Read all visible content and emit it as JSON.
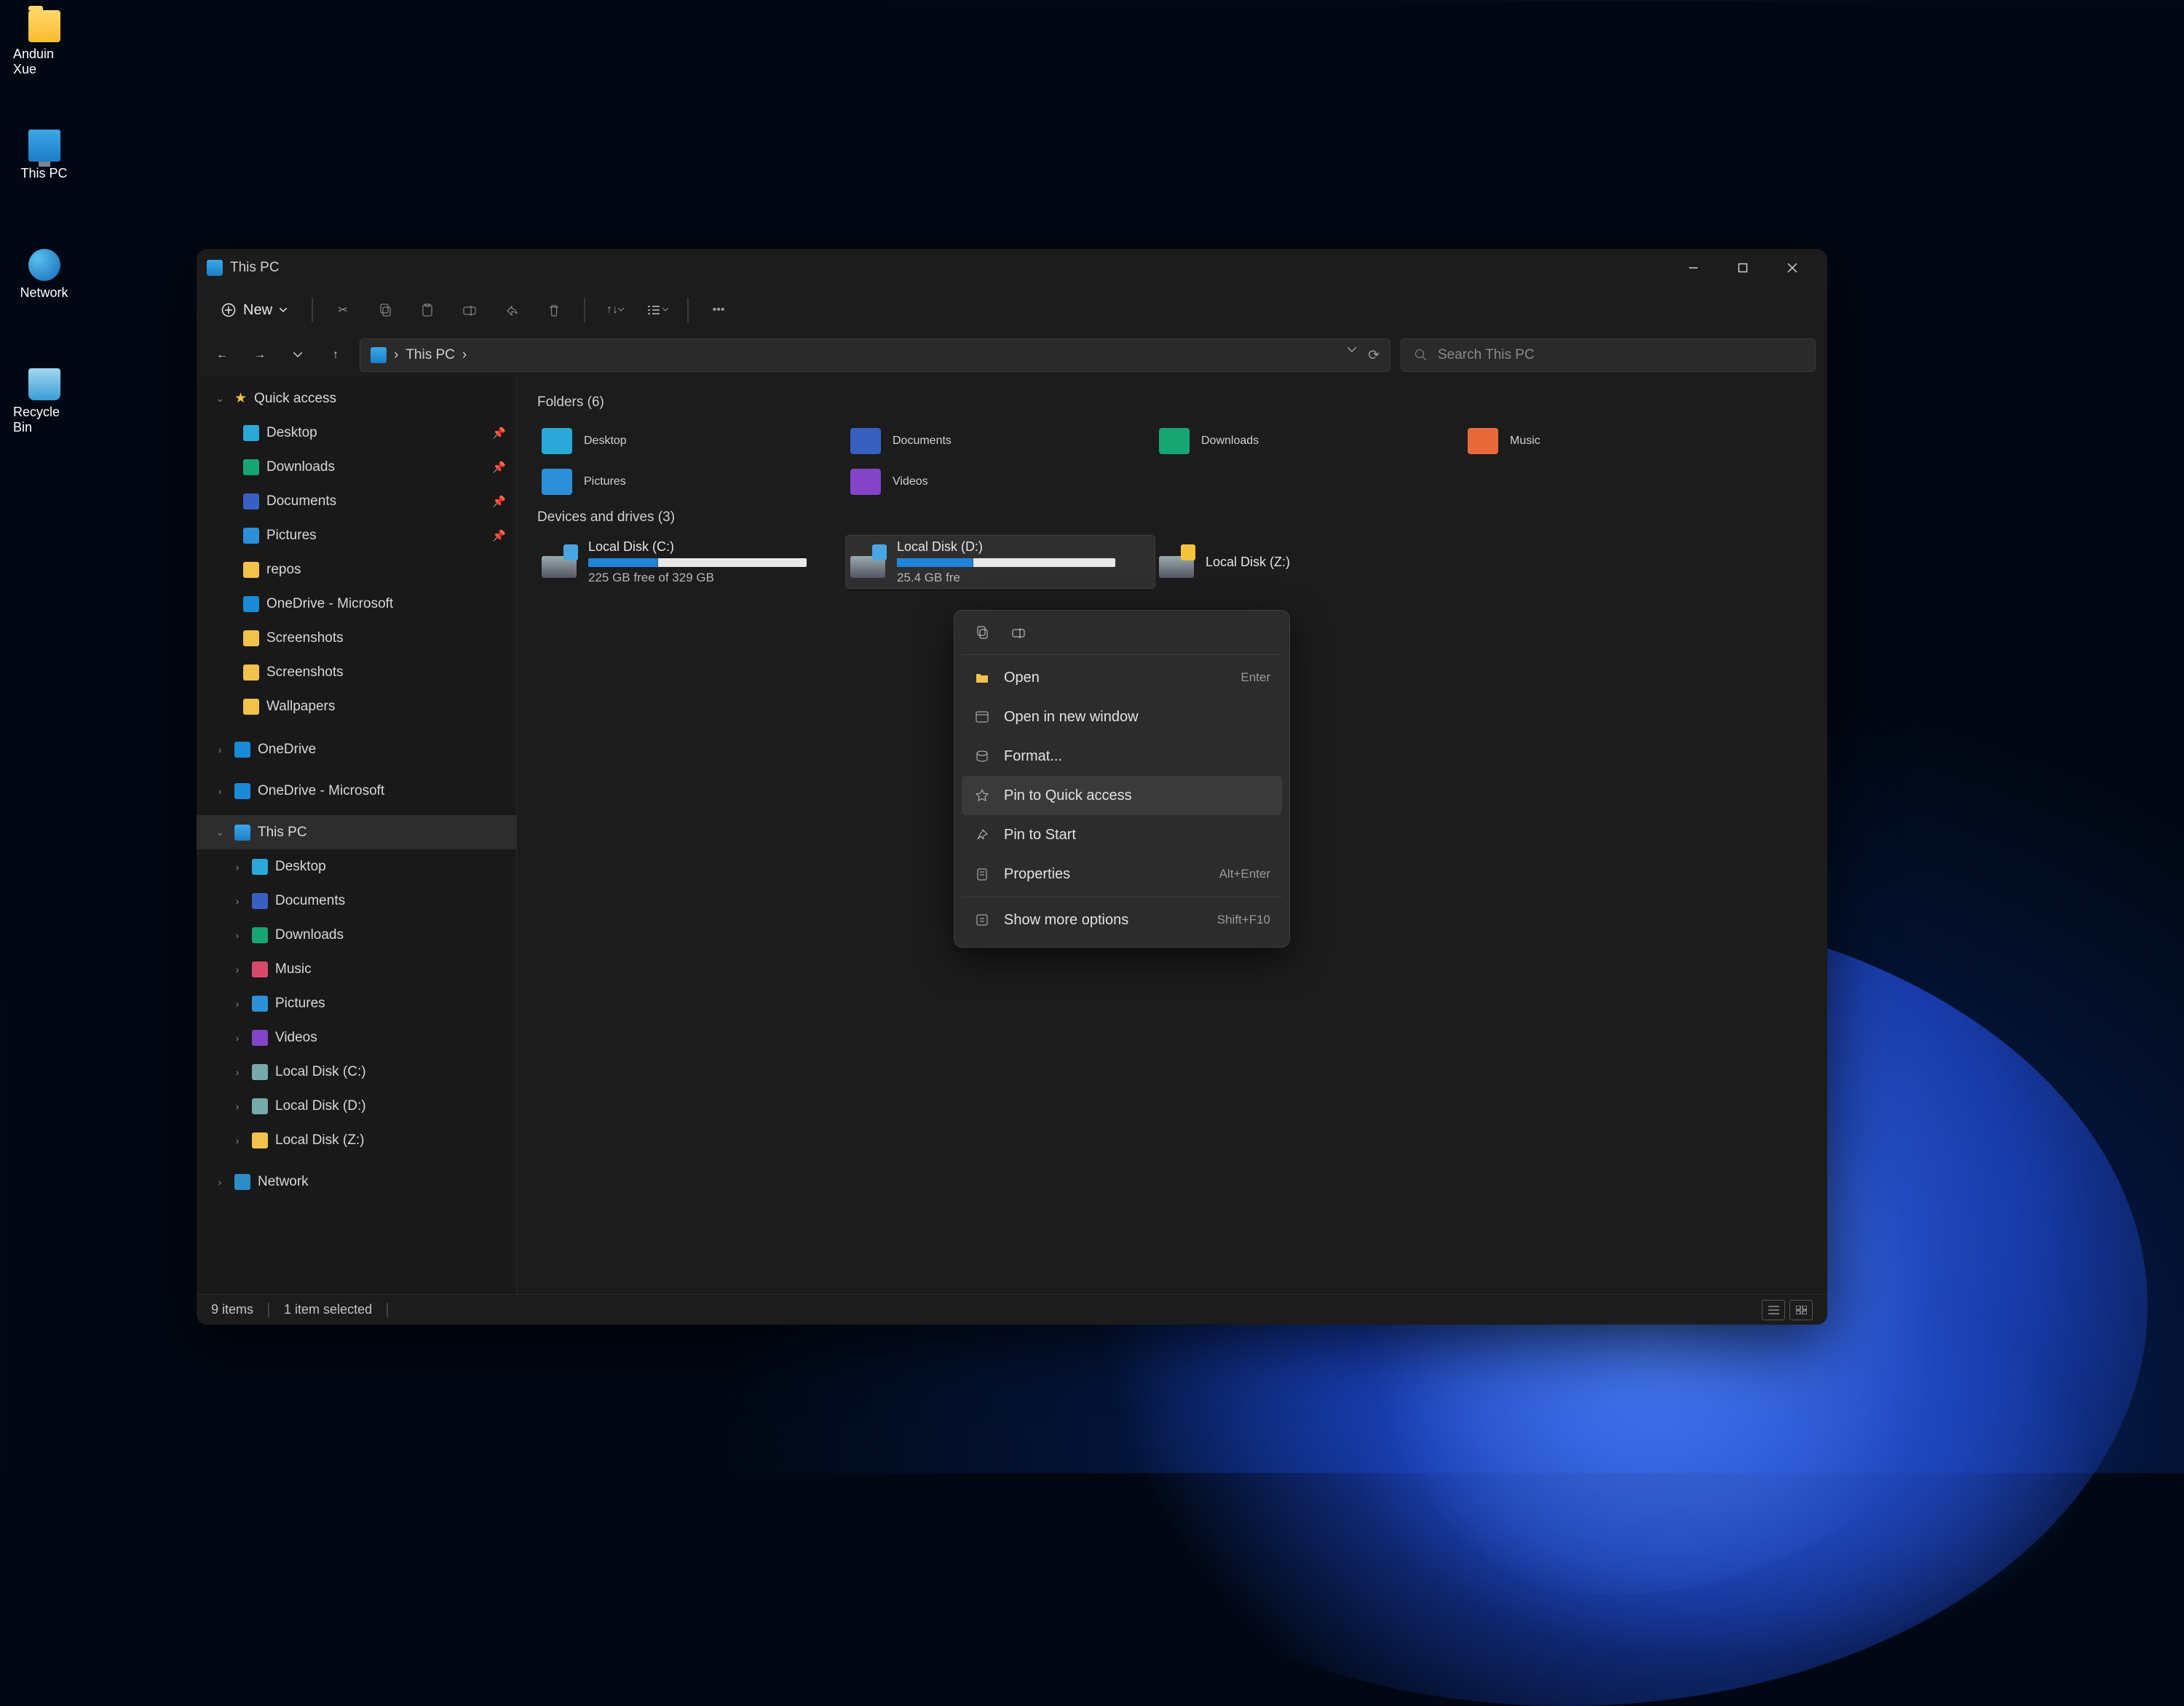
{
  "desktop": [
    {
      "name": "anduin",
      "label": "Anduin Xue",
      "icon": "folder"
    },
    {
      "name": "thispc",
      "label": "This PC",
      "icon": "pc"
    },
    {
      "name": "network",
      "label": "Network",
      "icon": "net"
    },
    {
      "name": "recycle",
      "label": "Recycle Bin",
      "icon": "bin"
    }
  ],
  "window": {
    "title": "This PC",
    "toolbar": {
      "new": "New"
    },
    "breadcrumb": "This PC",
    "search_placeholder": "Search This PC",
    "sidebar": {
      "quick": {
        "label": "Quick access",
        "items": [
          {
            "label": "Desktop",
            "pin": true,
            "color": "#2aa8d8"
          },
          {
            "label": "Downloads",
            "pin": true,
            "color": "#17a673"
          },
          {
            "label": "Documents",
            "pin": true,
            "color": "#3860c0"
          },
          {
            "label": "Pictures",
            "pin": true,
            "color": "#2b90d8"
          },
          {
            "label": "repos",
            "pin": false,
            "color": "#f3c24a"
          },
          {
            "label": "OneDrive - Microsoft",
            "pin": false,
            "color": "#1a8ad6"
          },
          {
            "label": "Screenshots",
            "pin": false,
            "color": "#f3c24a"
          },
          {
            "label": "Screenshots",
            "pin": false,
            "color": "#f3c24a"
          },
          {
            "label": "Wallpapers",
            "pin": false,
            "color": "#f3c24a"
          }
        ]
      },
      "onedrive": {
        "label": "OneDrive"
      },
      "onedrive_ms": {
        "label": "OneDrive - Microsoft"
      },
      "thispc": {
        "label": "This PC",
        "items": [
          {
            "label": "Desktop",
            "color": "#2aa8d8"
          },
          {
            "label": "Documents",
            "color": "#3860c0"
          },
          {
            "label": "Downloads",
            "color": "#17a673"
          },
          {
            "label": "Music",
            "color": "#d8486a"
          },
          {
            "label": "Pictures",
            "color": "#2b90d8"
          },
          {
            "label": "Videos",
            "color": "#8344c8"
          },
          {
            "label": "Local Disk (C:)",
            "color": "#7aa"
          },
          {
            "label": "Local Disk (D:)",
            "color": "#7aa"
          },
          {
            "label": "Local Disk (Z:)",
            "color": "#f3c24a"
          }
        ]
      },
      "network": {
        "label": "Network"
      }
    },
    "content": {
      "folders_header": "Folders (6)",
      "folders": [
        {
          "label": "Desktop",
          "color": "#2aa8d8"
        },
        {
          "label": "Documents",
          "color": "#3860c0"
        },
        {
          "label": "Downloads",
          "color": "#17a673"
        },
        {
          "label": "Music",
          "color": "#e86a3a"
        },
        {
          "label": "Pictures",
          "color": "#2b90d8"
        },
        {
          "label": "Videos",
          "color": "#8344c8"
        }
      ],
      "drives_header": "Devices and drives (3)",
      "drives": [
        {
          "label": "Local Disk (C:)",
          "free": "225 GB free of 329 GB",
          "pct": 32,
          "lock": "blue"
        },
        {
          "label": "Local Disk (D:)",
          "free": "25.4 GB fre",
          "pct": 35,
          "lock": "blue",
          "sel": true
        },
        {
          "label": "Local Disk (Z:)",
          "free": "",
          "pct": 0,
          "lock": "yellow"
        }
      ]
    },
    "status": {
      "items": "9 items",
      "selected": "1 item selected"
    }
  },
  "ctx": {
    "items": [
      {
        "icon": "folder",
        "label": "Open",
        "sc": "Enter",
        "hl": false
      },
      {
        "icon": "window",
        "label": "Open in new window",
        "sc": "",
        "hl": false
      },
      {
        "icon": "disk",
        "label": "Format...",
        "sc": "",
        "hl": false
      },
      {
        "icon": "star",
        "label": "Pin to Quick access",
        "sc": "",
        "hl": true
      },
      {
        "icon": "pin",
        "label": "Pin to Start",
        "sc": "",
        "hl": false
      },
      {
        "icon": "props",
        "label": "Properties",
        "sc": "Alt+Enter",
        "hl": false
      }
    ],
    "more": {
      "label": "Show more options",
      "sc": "Shift+F10"
    }
  }
}
